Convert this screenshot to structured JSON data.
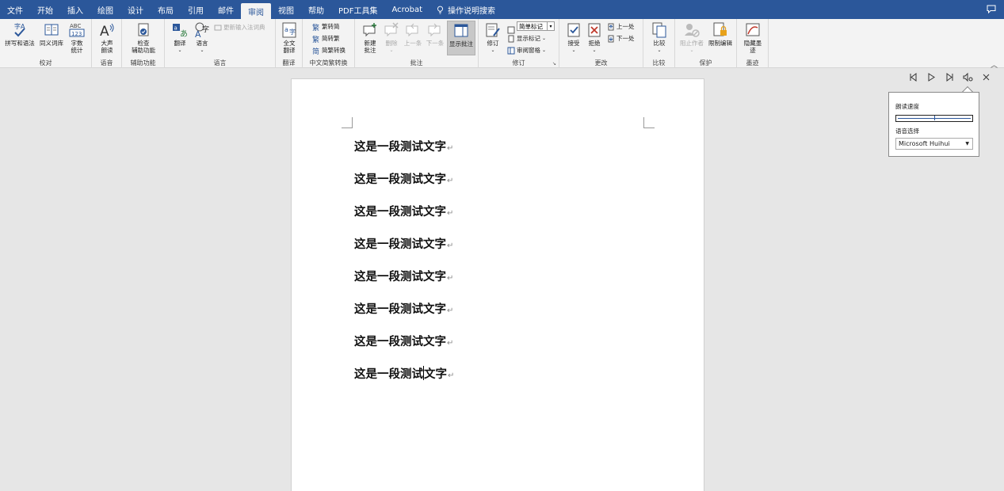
{
  "menu": {
    "tabs": [
      "文件",
      "开始",
      "插入",
      "绘图",
      "设计",
      "布局",
      "引用",
      "邮件",
      "审阅",
      "视图",
      "帮助",
      "PDF工具集",
      "Acrobat"
    ],
    "active_index": 8,
    "tell_me": "操作说明搜索"
  },
  "ribbon": {
    "proofing": {
      "label": "校对",
      "spelling": "拼写和语法",
      "thesaurus": "同义词库",
      "wordcount": "字数\n统计"
    },
    "speech": {
      "label": "语音",
      "read_aloud": "大声\n朗读"
    },
    "accessibility": {
      "label": "辅助功能",
      "check": "检查\n辅助功能"
    },
    "language": {
      "label": "语言",
      "translate": "翻译",
      "language": "语言",
      "update_ime": "更新输入法词典"
    },
    "translate_group": {
      "label": "翻译",
      "full_translate": "全文\n翻译"
    },
    "chinese_conv": {
      "label": "中文简繁转换",
      "to_simplified": "繁转简",
      "to_traditional": "简转繁",
      "conversion": "简繁转换"
    },
    "comments": {
      "label": "批注",
      "new": "新建\n批注",
      "delete": "删除",
      "prev": "上一条",
      "next": "下一条",
      "show": "显示批注"
    },
    "tracking": {
      "label": "修订",
      "track": "修订",
      "markup_combo": "简单标记",
      "show_markup": "显示标记",
      "review_pane": "审阅窗格"
    },
    "changes": {
      "label": "更改",
      "accept": "接受",
      "reject": "拒绝",
      "previous": "上一处",
      "next": "下一处"
    },
    "compare": {
      "label": "比较",
      "compare": "比较"
    },
    "protect": {
      "label": "保护",
      "block_authors": "阻止作者",
      "restrict": "限制编辑"
    },
    "ink": {
      "label": "墨迹",
      "hide_ink": "隐藏墨\n迹"
    }
  },
  "document": {
    "lines": [
      "这是一段测试文字",
      "这是一段测试文字",
      "这是一段测试文字",
      "这是一段测试文字",
      "这是一段测试文字",
      "这是一段测试文字",
      "这是一段测试文字"
    ],
    "last_before_caret": "这是一段测试",
    "last_after_caret": "文字",
    "para_mark": "↵"
  },
  "read_aloud": {
    "speed_label": "朗读速度",
    "speed_value": 0.5,
    "voice_label": "语音选择",
    "voice_value": "Microsoft Huihui"
  },
  "colors": {
    "brand": "#2b579a",
    "ribbon_bg": "#f3f3f3",
    "canvas_bg": "#e6e6e6"
  }
}
